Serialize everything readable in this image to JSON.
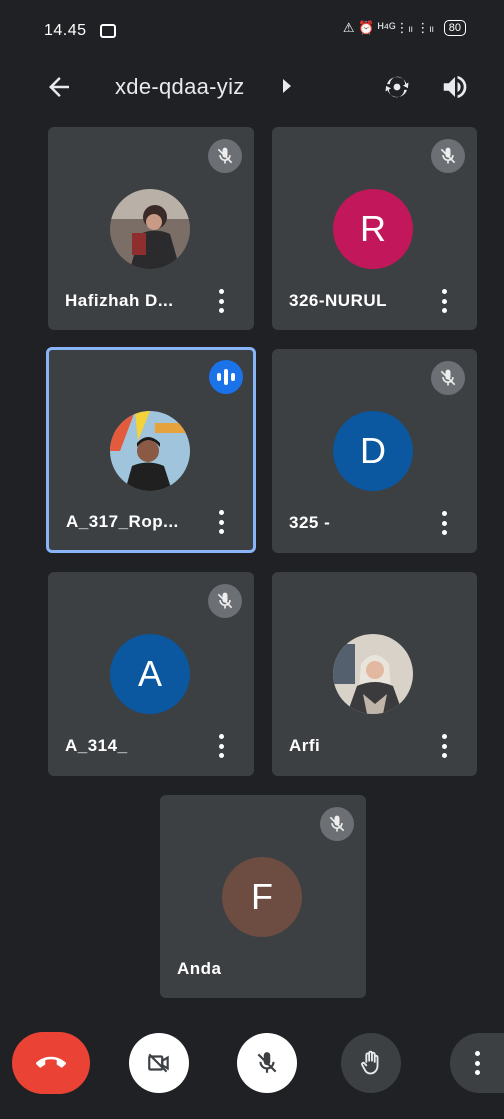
{
  "status": {
    "time": "14.45",
    "indicators": "⚠ ⏰ ᴴ⁴ᴳ⋮ₗₗ ⋮ₗₗ",
    "battery": "80"
  },
  "meeting": {
    "code": "xde-qdaa-yiz"
  },
  "participants": [
    {
      "name": "Hafizhah D...",
      "avatar_type": "photo",
      "muted": true
    },
    {
      "name": "326-NURUL",
      "initial": "R",
      "color": "#c2185b",
      "muted": true
    },
    {
      "name": "A_317_Rop...",
      "avatar_type": "photo",
      "speaking": true
    },
    {
      "name": "325 -",
      "initial": "D",
      "color": "#0b57a0",
      "muted": true
    },
    {
      "name": "A_314_",
      "initial": "A",
      "color": "#0b57a0",
      "muted": true
    },
    {
      "name": "Arfi",
      "avatar_type": "photo",
      "muted": false
    },
    {
      "name": "Anda",
      "initial": "F",
      "color": "#6d4c41",
      "muted": true
    }
  ],
  "controls": {
    "end_call_color": "#ea4335",
    "camera": "camera-off",
    "mic": "mic-off",
    "hand": "raise-hand",
    "more": "more"
  }
}
